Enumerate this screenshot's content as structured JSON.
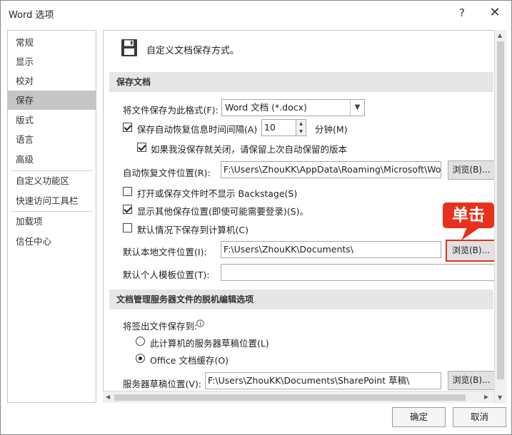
{
  "window": {
    "title": "Word 选项",
    "help_glyph": "?",
    "close_glyph": "✕"
  },
  "nav": {
    "items": [
      {
        "label": "常规"
      },
      {
        "label": "显示"
      },
      {
        "label": "校对"
      },
      {
        "label": "保存"
      },
      {
        "label": "版式"
      },
      {
        "label": "语言"
      },
      {
        "label": "高级"
      },
      {
        "label": "自定义功能区"
      },
      {
        "label": "快速访问工具栏"
      },
      {
        "label": "加载项"
      },
      {
        "label": "信任中心"
      }
    ],
    "selected": "保存"
  },
  "page": {
    "heading": "自定义文档保存方式。",
    "heading_icon": "floppy-disk-icon"
  },
  "save_section": {
    "header": "保存文档",
    "format_label": "将文件保存为此格式(F):",
    "format_value": "Word 文档 (*.docx)",
    "autorecover_label": "保存自动恢复信息时间间隔(A)",
    "autorecover_checked": true,
    "autorecover_minutes": "10",
    "minutes_unit": "分钟(M)",
    "keep_last_label": "如果我没保存就关闭，请保留上次自动保留的版本",
    "keep_last_checked": true,
    "autorecover_location_label": "自动恢复文件位置(R):",
    "autorecover_location_value": "F:\\Users\\ZhouKK\\AppData\\Roaming\\Microsoft\\Wor",
    "browse_label": "浏览(B)...",
    "no_backstage_label": "打开或保存文件时不显示 Backstage(S)",
    "no_backstage_checked": false,
    "show_other_label": "显示其他保存位置(即使可能需要登录)(S)。",
    "show_other_checked": true,
    "save_to_computer_label": "默认情况下保存到计算机(C)",
    "save_to_computer_checked": false,
    "local_location_label": "默认本地文件位置(I):",
    "local_location_value": "F:\\Users\\ZhouKK\\Documents\\",
    "template_location_label": "默认个人模板位置(T):",
    "template_location_value": ""
  },
  "offline_section": {
    "header": "文档管理服务器文件的脱机编辑选项",
    "checkout_label": "将签出文件保存到:",
    "info_icon": "info-icon",
    "option_server": "此计算机的服务器草稿位置(L)",
    "option_cache": "Office 文档缓存(O)",
    "selected_option": "Office 文档缓存(O)",
    "drafts_label": "服务器草稿位置(V):",
    "drafts_value": "F:\\Users\\ZhouKK\\Documents\\SharePoint 草稿\\"
  },
  "callout": {
    "text": "单击",
    "color": "#e8301c"
  },
  "footer": {
    "ok_label": "确定",
    "cancel_label": "取消"
  },
  "colors": {
    "nav_selected": "#c5c5c5",
    "section_header": "#e6e6e6",
    "highlight_border": "#e0301e"
  }
}
